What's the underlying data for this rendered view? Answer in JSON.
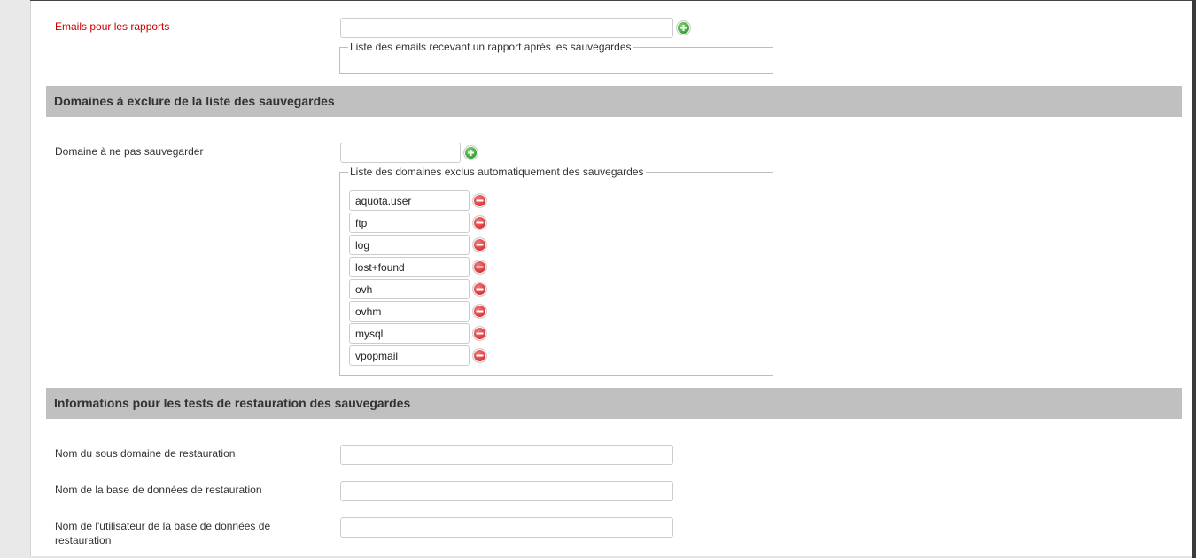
{
  "reports": {
    "label": "Emails pour les rapports",
    "input_value": "",
    "list_legend": "Liste des emails recevant un rapport aprés les sauvegardes",
    "add_icon": "plus-circle-icon",
    "required_color": "#cc0000"
  },
  "exclude_section": {
    "title": "Domaines à exclure de la liste des sauvegardes",
    "label": "Domaine à ne pas sauvegarder",
    "input_value": "",
    "list_legend": "Liste des domaines exclus automatiquement des sauvegardes",
    "items": [
      {
        "value": "aquota.user"
      },
      {
        "value": "ftp"
      },
      {
        "value": "log"
      },
      {
        "value": "lost+found"
      },
      {
        "value": "ovh"
      },
      {
        "value": "ovhm"
      },
      {
        "value": "mysql"
      },
      {
        "value": "vpopmail"
      }
    ],
    "remove_icon": "minus-circle-icon"
  },
  "restore_section": {
    "title": "Informations pour les tests de restauration des sauvegardes",
    "subdomain_label": "Nom du sous domaine de restauration",
    "subdomain_value": "",
    "db_name_label": "Nom de la base de données de restauration",
    "db_name_value": "",
    "db_user_label_line1": "Nom de l'utilisateur de la base de données de",
    "db_user_label_line2": "restauration",
    "db_user_value": ""
  },
  "colors": {
    "section_header_bg": "#c0c0c0",
    "add_green": "#3aa53a",
    "remove_red": "#d83a3a"
  }
}
